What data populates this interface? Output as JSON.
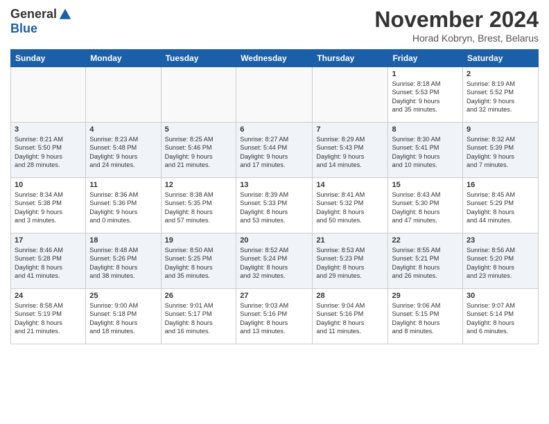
{
  "header": {
    "logo_general": "General",
    "logo_blue": "Blue",
    "month_title": "November 2024",
    "location": "Horad Kobryn, Brest, Belarus"
  },
  "days_of_week": [
    "Sunday",
    "Monday",
    "Tuesday",
    "Wednesday",
    "Thursday",
    "Friday",
    "Saturday"
  ],
  "weeks": [
    [
      {
        "day": "",
        "info": ""
      },
      {
        "day": "",
        "info": ""
      },
      {
        "day": "",
        "info": ""
      },
      {
        "day": "",
        "info": ""
      },
      {
        "day": "",
        "info": ""
      },
      {
        "day": "1",
        "info": "Sunrise: 8:18 AM\nSunset: 5:53 PM\nDaylight: 9 hours\nand 35 minutes."
      },
      {
        "day": "2",
        "info": "Sunrise: 8:19 AM\nSunset: 5:52 PM\nDaylight: 9 hours\nand 32 minutes."
      }
    ],
    [
      {
        "day": "3",
        "info": "Sunrise: 8:21 AM\nSunset: 5:50 PM\nDaylight: 9 hours\nand 28 minutes."
      },
      {
        "day": "4",
        "info": "Sunrise: 8:23 AM\nSunset: 5:48 PM\nDaylight: 9 hours\nand 24 minutes."
      },
      {
        "day": "5",
        "info": "Sunrise: 8:25 AM\nSunset: 5:46 PM\nDaylight: 9 hours\nand 21 minutes."
      },
      {
        "day": "6",
        "info": "Sunrise: 8:27 AM\nSunset: 5:44 PM\nDaylight: 9 hours\nand 17 minutes."
      },
      {
        "day": "7",
        "info": "Sunrise: 8:29 AM\nSunset: 5:43 PM\nDaylight: 9 hours\nand 14 minutes."
      },
      {
        "day": "8",
        "info": "Sunrise: 8:30 AM\nSunset: 5:41 PM\nDaylight: 9 hours\nand 10 minutes."
      },
      {
        "day": "9",
        "info": "Sunrise: 8:32 AM\nSunset: 5:39 PM\nDaylight: 9 hours\nand 7 minutes."
      }
    ],
    [
      {
        "day": "10",
        "info": "Sunrise: 8:34 AM\nSunset: 5:38 PM\nDaylight: 9 hours\nand 3 minutes."
      },
      {
        "day": "11",
        "info": "Sunrise: 8:36 AM\nSunset: 5:36 PM\nDaylight: 9 hours\nand 0 minutes."
      },
      {
        "day": "12",
        "info": "Sunrise: 8:38 AM\nSunset: 5:35 PM\nDaylight: 8 hours\nand 57 minutes."
      },
      {
        "day": "13",
        "info": "Sunrise: 8:39 AM\nSunset: 5:33 PM\nDaylight: 8 hours\nand 53 minutes."
      },
      {
        "day": "14",
        "info": "Sunrise: 8:41 AM\nSunset: 5:32 PM\nDaylight: 8 hours\nand 50 minutes."
      },
      {
        "day": "15",
        "info": "Sunrise: 8:43 AM\nSunset: 5:30 PM\nDaylight: 8 hours\nand 47 minutes."
      },
      {
        "day": "16",
        "info": "Sunrise: 8:45 AM\nSunset: 5:29 PM\nDaylight: 8 hours\nand 44 minutes."
      }
    ],
    [
      {
        "day": "17",
        "info": "Sunrise: 8:46 AM\nSunset: 5:28 PM\nDaylight: 8 hours\nand 41 minutes."
      },
      {
        "day": "18",
        "info": "Sunrise: 8:48 AM\nSunset: 5:26 PM\nDaylight: 8 hours\nand 38 minutes."
      },
      {
        "day": "19",
        "info": "Sunrise: 8:50 AM\nSunset: 5:25 PM\nDaylight: 8 hours\nand 35 minutes."
      },
      {
        "day": "20",
        "info": "Sunrise: 8:52 AM\nSunset: 5:24 PM\nDaylight: 8 hours\nand 32 minutes."
      },
      {
        "day": "21",
        "info": "Sunrise: 8:53 AM\nSunset: 5:23 PM\nDaylight: 8 hours\nand 29 minutes."
      },
      {
        "day": "22",
        "info": "Sunrise: 8:55 AM\nSunset: 5:21 PM\nDaylight: 8 hours\nand 26 minutes."
      },
      {
        "day": "23",
        "info": "Sunrise: 8:56 AM\nSunset: 5:20 PM\nDaylight: 8 hours\nand 23 minutes."
      }
    ],
    [
      {
        "day": "24",
        "info": "Sunrise: 8:58 AM\nSunset: 5:19 PM\nDaylight: 8 hours\nand 21 minutes."
      },
      {
        "day": "25",
        "info": "Sunrise: 9:00 AM\nSunset: 5:18 PM\nDaylight: 8 hours\nand 18 minutes."
      },
      {
        "day": "26",
        "info": "Sunrise: 9:01 AM\nSunset: 5:17 PM\nDaylight: 8 hours\nand 16 minutes."
      },
      {
        "day": "27",
        "info": "Sunrise: 9:03 AM\nSunset: 5:16 PM\nDaylight: 8 hours\nand 13 minutes."
      },
      {
        "day": "28",
        "info": "Sunrise: 9:04 AM\nSunset: 5:16 PM\nDaylight: 8 hours\nand 11 minutes."
      },
      {
        "day": "29",
        "info": "Sunrise: 9:06 AM\nSunset: 5:15 PM\nDaylight: 8 hours\nand 8 minutes."
      },
      {
        "day": "30",
        "info": "Sunrise: 9:07 AM\nSunset: 5:14 PM\nDaylight: 8 hours\nand 6 minutes."
      }
    ]
  ]
}
